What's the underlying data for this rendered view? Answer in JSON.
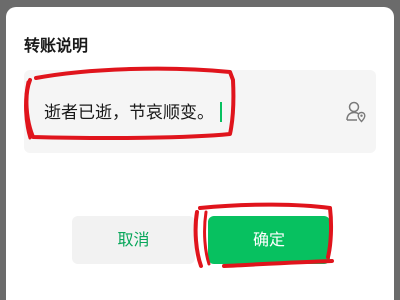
{
  "dialog": {
    "title": "转账说明",
    "remark_value": "逝者已逝，节哀顺变。",
    "contact_icon": "contact-location-icon",
    "cancel_label": "取消",
    "confirm_label": "确定"
  },
  "colors": {
    "accent": "#07c160",
    "cancel_text": "#07a65a",
    "annotation": "#e0141c"
  }
}
